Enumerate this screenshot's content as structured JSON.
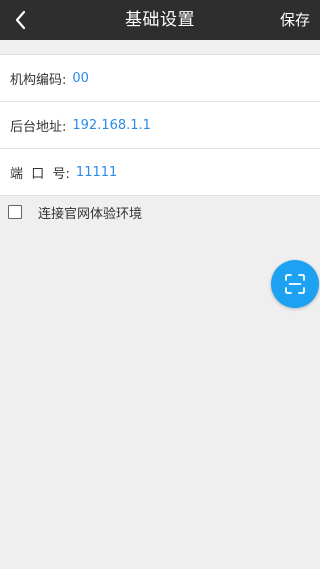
{
  "header": {
    "title": "基础设置",
    "save_label": "保存",
    "back_icon": "chevron-left-icon"
  },
  "form": {
    "rows": [
      {
        "label": "机构编码:",
        "value": "00"
      },
      {
        "label": "后台地址:",
        "value": "192.168.1.1"
      },
      {
        "label": "端  口  号:",
        "value": "11111"
      }
    ]
  },
  "experience": {
    "label": "连接官网体验环境",
    "checked": false
  },
  "fab": {
    "icon": "scan-icon"
  },
  "colors": {
    "header_bg": "#2e2e2e",
    "value_text": "#2b8be6",
    "fab_bg": "#1da1f2",
    "page_bg": "#efefef"
  }
}
